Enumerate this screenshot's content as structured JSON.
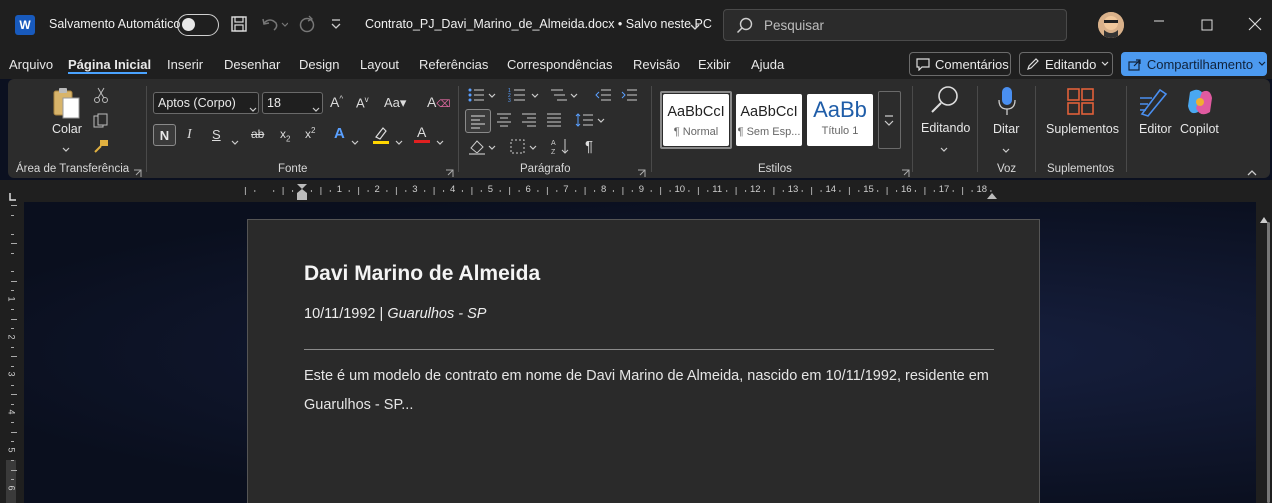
{
  "app": {
    "autosave_label": "Salvamento Automático",
    "doc_title": "Contrato_PJ_Davi_Marino_de_Almeida.docx • Salvo neste PC",
    "search_placeholder": "Pesquisar"
  },
  "menu": {
    "items": [
      "Arquivo",
      "Página Inicial",
      "Inserir",
      "Desenhar",
      "Design",
      "Layout",
      "Referências",
      "Correspondências",
      "Revisão",
      "Exibir",
      "Ajuda"
    ],
    "active": "Página Inicial"
  },
  "header_buttons": {
    "comments": "Comentários",
    "editing": "Editando",
    "share": "Compartilhamento"
  },
  "ribbon": {
    "paste": "Colar",
    "clipboard_label": "Área de Transferência",
    "font": "Aptos (Corpo)",
    "size": "18",
    "font_label": "Fonte",
    "paragraph_label": "Parágrafo",
    "styles": [
      {
        "sample": "AaBbCcI",
        "name": "¶ Normal"
      },
      {
        "sample": "AaBbCcI",
        "name": "¶ Sem Esp..."
      },
      {
        "sample": "AaBb",
        "name": "Título 1"
      }
    ],
    "styles_label": "Estilos",
    "editing": "Editando",
    "dictate": "Ditar",
    "voice_label": "Voz",
    "addins": "Suplementos",
    "addins_label": "Suplementos",
    "editor": "Editor",
    "copilot": "Copilot",
    "bold": "N",
    "italic": "I",
    "underline": "S"
  },
  "ruler": {
    "numbers": [
      "1",
      "2",
      "3",
      "4",
      "5",
      "6",
      "7",
      "8",
      "9",
      "10",
      "11",
      "12",
      "13",
      "14",
      "15",
      "16",
      "17",
      "18"
    ]
  },
  "vruler": {
    "numbers": [
      "1",
      "2",
      "3",
      "4",
      "5",
      "6"
    ]
  },
  "document": {
    "name": "Davi Marino de Almeida",
    "info_date": "10/11/1992 | ",
    "info_city": "Guarulhos - SP",
    "body": "Este é um modelo de contrato em nome de Davi Marino de Almeida, nascido em 10/11/1992, residente em Guarulhos - SP..."
  },
  "colors": {
    "accent": "#4c9af0",
    "highlight": "#ffd600",
    "font_color": "#e02020"
  }
}
